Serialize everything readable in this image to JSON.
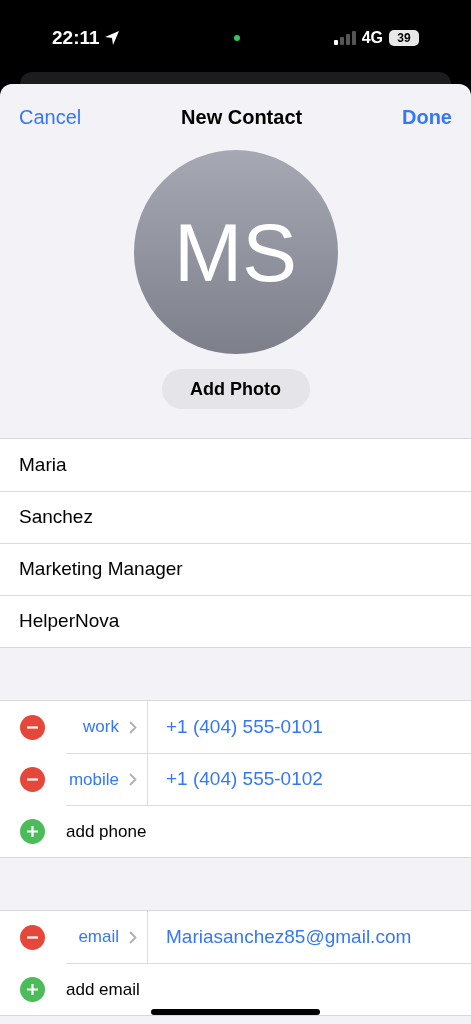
{
  "status_bar": {
    "time": "22:11",
    "network": "4G",
    "battery": "39"
  },
  "header": {
    "cancel": "Cancel",
    "title": "New Contact",
    "done": "Done"
  },
  "avatar": {
    "initials": "MS",
    "button": "Add Photo"
  },
  "name_fields": [
    {
      "value": "Maria"
    },
    {
      "value": "Sanchez"
    },
    {
      "value": "Marketing Manager"
    },
    {
      "value": "HelperNova"
    }
  ],
  "phone_section": [
    {
      "kind": "entry",
      "label": "work",
      "value": "+1 (404) 555-0101"
    },
    {
      "kind": "entry",
      "label": "mobile",
      "value": "+1 (404) 555-0102"
    },
    {
      "kind": "add",
      "label": "add phone"
    }
  ],
  "email_section": [
    {
      "kind": "entry",
      "label": "email",
      "value": "Mariasanchez85@gmail.com"
    },
    {
      "kind": "add",
      "label": "add email"
    }
  ]
}
